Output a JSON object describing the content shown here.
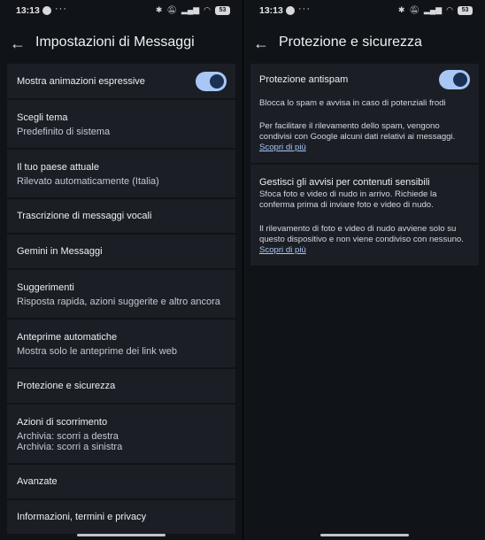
{
  "status_bar": {
    "time": "13:13",
    "more": "···",
    "battery": "53"
  },
  "left": {
    "title": "Impostazioni di Messaggi",
    "items": [
      {
        "title": "Mostra animazioni espressive",
        "toggle_on": true
      },
      {
        "title": "Scegli tema",
        "subtitle": "Predefinito di sistema"
      },
      {
        "title": "Il tuo paese attuale",
        "subtitle": "Rilevato automaticamente (Italia)"
      },
      {
        "title": "Trascrizione di messaggi vocali"
      },
      {
        "title": "Gemini in Messaggi"
      },
      {
        "title": "Suggerimenti",
        "subtitle": "Risposta rapida, azioni suggerite e altro ancora"
      },
      {
        "title": "Anteprime automatiche",
        "subtitle": "Mostra solo le anteprime dei link web"
      },
      {
        "title": "Protezione e sicurezza"
      },
      {
        "title": "Azioni di scorrimento",
        "subtitle": "Archivia: scorri a destra",
        "subtitle2": "Archivia: scorri a sinistra"
      },
      {
        "title": "Avanzate"
      },
      {
        "title": "Informazioni, termini e privacy"
      }
    ]
  },
  "right": {
    "title": "Protezione e sicurezza",
    "antispam": {
      "title": "Protezione antispam",
      "toggle_on": true,
      "line1": "Blocca lo spam e avvisa in caso di potenziali frodi",
      "p1": "Per facilitare il rilevamento dello spam, vengono",
      "p2": "condivisi con Google alcuni dati relativi ai messaggi.",
      "link": "Scopri di più"
    },
    "sensitive": {
      "title": "Gestisci gli avvisi per contenuti sensibili",
      "l1": "Sfoca foto e video di nudo in arrivo. Richiede la",
      "l2": "conferma prima di inviare foto e video di nudo.",
      "l3": "Il rilevamento di foto e video di nudo avviene solo su",
      "l4": "questo dispositivo e non viene condiviso con nessuno.",
      "link": "Scopri di più"
    }
  }
}
